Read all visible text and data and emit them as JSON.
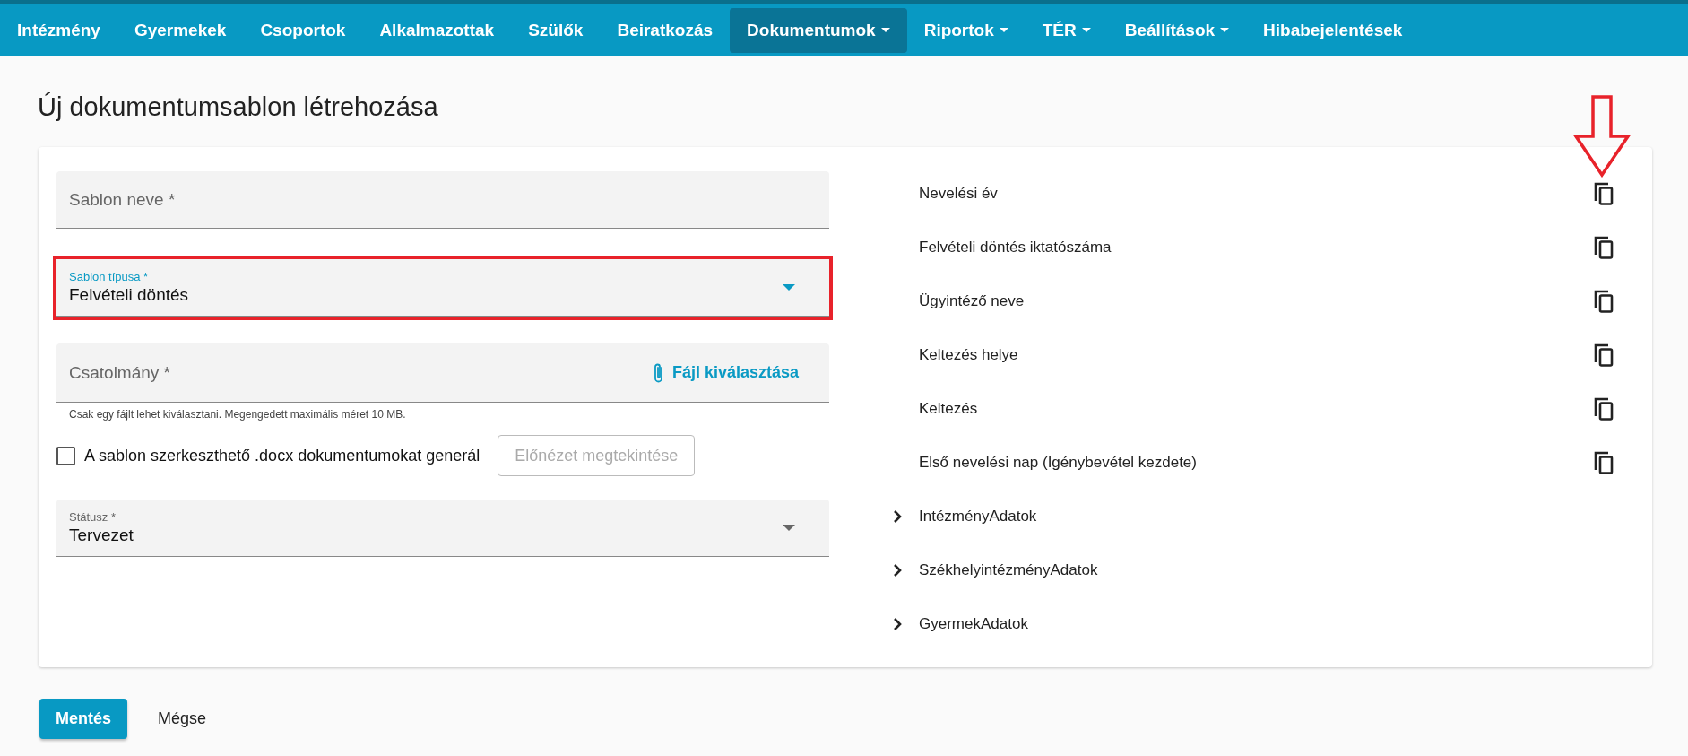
{
  "nav": [
    {
      "label": "Intézmény",
      "selected": false,
      "has_menu": false
    },
    {
      "label": "Gyermekek",
      "selected": false,
      "has_menu": false
    },
    {
      "label": "Csoportok",
      "selected": false,
      "has_menu": false
    },
    {
      "label": "Alkalmazottak",
      "selected": false,
      "has_menu": false
    },
    {
      "label": "Szülők",
      "selected": false,
      "has_menu": false
    },
    {
      "label": "Beiratkozás",
      "selected": false,
      "has_menu": false
    },
    {
      "label": "Dokumentumok",
      "selected": true,
      "has_menu": true
    },
    {
      "label": "Riportok",
      "selected": false,
      "has_menu": true
    },
    {
      "label": "TÉR",
      "selected": false,
      "has_menu": true
    },
    {
      "label": "Beállítások",
      "selected": false,
      "has_menu": true
    },
    {
      "label": "Hibabejelentések",
      "selected": false,
      "has_menu": false
    }
  ],
  "page_title": "Új dokumentumsablon létrehozása",
  "form": {
    "fields": [
      {
        "kind": "text",
        "label": "Sablon neve *",
        "highlighted": false
      },
      {
        "kind": "select",
        "label": "Sablon típusa *",
        "value": "Felvételi döntés",
        "focused": true,
        "highlighted": true
      },
      {
        "kind": "file",
        "label": "Csatolmány *",
        "action": "Fájl kiválasztása",
        "hint": "Csak egy fájlt lehet kiválasztani. Megengedett maximális méret 10 MB.",
        "highlighted": false
      },
      {
        "kind": "checkbox",
        "label": "A sablon szerkeszthető .docx dokumentumokat generál",
        "checked": false,
        "button": "Előnézet megtekintése",
        "button_disabled": true,
        "highlighted": false
      },
      {
        "kind": "select",
        "label": "Státusz *",
        "value": "Tervezet",
        "focused": false,
        "highlighted": false
      }
    ]
  },
  "variables": [
    {
      "label": "Nevelési év",
      "marked": true
    },
    {
      "label": "Felvételi döntés iktatószáma",
      "marked": false
    },
    {
      "label": "Ügyintéző neve",
      "marked": false
    },
    {
      "label": "Keltezés helye",
      "marked": false
    },
    {
      "label": "Keltezés",
      "marked": false
    },
    {
      "label": "Első nevelési nap (Igénybevétel kezdete)",
      "marked": false
    }
  ],
  "groups": [
    {
      "label": "IntézményAdatok",
      "expanded": false
    },
    {
      "label": "SzékhelyintézményAdatok",
      "expanded": false
    },
    {
      "label": "GyermekAdatok",
      "expanded": false
    }
  ],
  "buttons": {
    "save": "Mentés",
    "cancel": "Mégse"
  }
}
